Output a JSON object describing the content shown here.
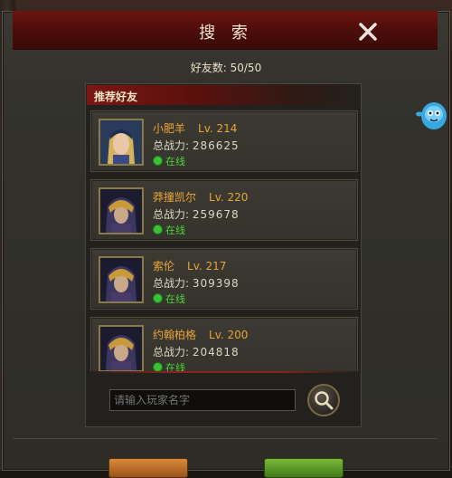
{
  "dialog": {
    "title": "搜 索",
    "friend_count": "好友数: 50/50"
  },
  "recommended": {
    "header": "推荐好友",
    "power_label": "总战力:",
    "friends": [
      {
        "name": "小肥羊",
        "level": "Lv. 214",
        "power": "286625",
        "status": "在线"
      },
      {
        "name": "莽撞凯尔",
        "level": "Lv. 220",
        "power": "259678",
        "status": "在线"
      },
      {
        "name": "索伦",
        "level": "Lv. 217",
        "power": "309398",
        "status": "在线"
      },
      {
        "name": "约翰柏格",
        "level": "Lv. 200",
        "power": "204818",
        "status": "在线"
      }
    ]
  },
  "search": {
    "placeholder": "请输入玩家名字"
  },
  "colors": {
    "title_bar": "#5a100c",
    "name": "#e8a53a",
    "online": "#4ed33a",
    "panel_header": "#7a1712"
  }
}
